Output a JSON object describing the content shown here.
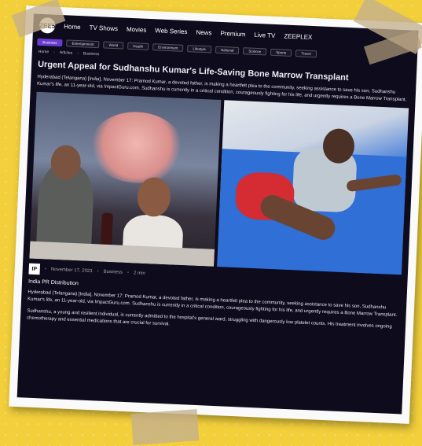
{
  "nav": {
    "logo_text": "ZEE5",
    "links": [
      "Home",
      "TV Shows",
      "Movies",
      "Web Series",
      "News",
      "Premium",
      "Live TV",
      "ZEEPLEX"
    ]
  },
  "categories": [
    "Business",
    "Entertainment",
    "World",
    "Health",
    "Environment",
    "Lifestyle",
    "National",
    "Science",
    "Sports",
    "Travel"
  ],
  "breadcrumb": [
    "Home",
    "Articles",
    "Business"
  ],
  "article": {
    "title": "Urgent Appeal for Sudhanshu Kumar's Life-Saving Bone Marrow Transplant",
    "lead": "Hyderabad (Telangana) [India], November 17: Pramod Kumar, a devoted father, is making a heartfelt plea to the community, seeking assistance to save his son, Sudhanshu Kumar's life, an 11-year-old, via ImpactGuru.com. Sudhanshu is currently in a critical condition, courageously fighting for his life, and urgently requires a Bone Marrow Transplant.",
    "meta": {
      "badge": "IP",
      "date": "November 17, 2023",
      "category": "Business",
      "read_time": "2 min"
    },
    "source": "India PR Distribution",
    "paragraphs": [
      "Hyderabad (Telangana) [India], November 17: Pramod Kumar, a devoted father, is making a heartfelt plea to the community, seeking assistance to save his son, Sudhanshu Kumar's life, an 11-year-old, via ImpactGuru.com. Sudhanshu is currently in a critical condition, courageously fighting for his life, and urgently requires a Bone Marrow Transplant.",
      "Sudhanshu, a young and resilient individual, is currently admitted to the hospital's general ward, struggling with dangerously low platelet counts. His treatment involves ongoing chemotherapy and essential medications that are crucial for survival."
    ]
  },
  "colors": {
    "background": "#f2cf3b",
    "screen": "#0d0b1c",
    "active_category": "#6a3bd1"
  }
}
